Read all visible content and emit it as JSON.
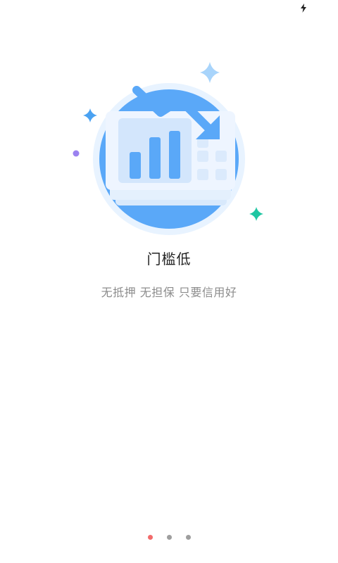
{
  "status_bar": {
    "charging_icon": "charging-bolt-icon"
  },
  "illustration": {
    "icon": "declining-bar-chart-icon",
    "colors": {
      "circle": "#5aa8f8",
      "halo": "#e3f0ff",
      "card": "#e9f3ff",
      "bars": "#5aa8f8",
      "arrow": "#5aa8f8",
      "sparkle_blue": "#4aa2f2",
      "sparkle_light": "#a8d4fb",
      "sparkle_teal": "#1fc6a2",
      "dot_purple": "#9b82f0"
    }
  },
  "onboarding": {
    "title": "门槛低",
    "subtitle": "无抵押 无担保 只要信用好"
  },
  "pager": {
    "total_pages": 3,
    "current_page": 1,
    "active_color": "#f26b6b",
    "inactive_color": "#9e9e9e"
  }
}
